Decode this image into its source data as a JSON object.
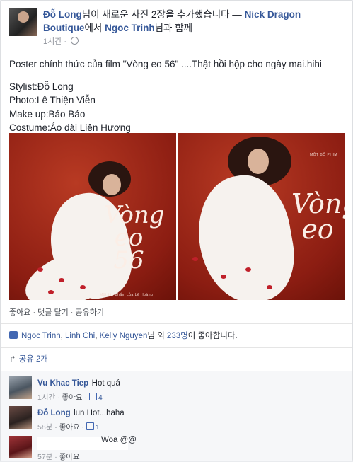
{
  "post": {
    "author": "Đỗ Long",
    "action_text": "님이 새로운 사진 2장을 추가했습니다 —",
    "tagged_page": "Nick Dragon Boutique",
    "with_text": "에서",
    "tagged_person": "Ngoc Trinh",
    "together_text": "님과 함께",
    "time": "1시간",
    "body": [
      "Poster chính thức của film \"Vòng eo 56\" ....Thật hồi hộp cho ngày mai.hihi",
      "",
      "Stylist:Đỗ Long",
      "Photo:Lê Thiện Viễn",
      "Make up:Bảo Bảo",
      "Costume:Áo dài Liên Hương"
    ],
    "photos": [
      {
        "title": "Vòng eo 56",
        "caption": "Một tác phẩm của Lê Hoàng"
      },
      {
        "title": "Vòng eo",
        "caption": "MỘT BỘ PHIM"
      }
    ]
  },
  "actions": {
    "like": "좋아요",
    "comment": "댓글 달기",
    "share": "공유하기",
    "sep": "·"
  },
  "likes": {
    "names": [
      "Ngoc Trinh",
      "Linh Chi",
      "Kelly Nguyen"
    ],
    "suffix_pre": "님 외",
    "count": "233명",
    "suffix_post": "이 좋아합니다."
  },
  "shares": {
    "label": "공유 2개"
  },
  "comments": [
    {
      "author": "Vu Khac Tiep",
      "text": "Hot quá",
      "time": "1시간",
      "like": "좋아요",
      "count": "4"
    },
    {
      "author": "Đỗ Long",
      "text": "lun Hot...haha",
      "time": "58분",
      "like": "좋아요",
      "count": "1"
    },
    {
      "author": "",
      "text": "Woa @@",
      "time": "57분",
      "like": "좋아요",
      "count": ""
    }
  ]
}
